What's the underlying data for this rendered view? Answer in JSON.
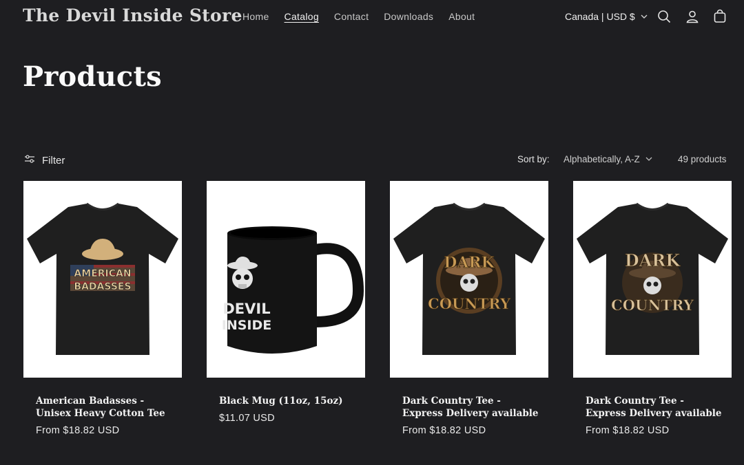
{
  "store": {
    "name": "The Devil Inside Store"
  },
  "nav": {
    "items": [
      {
        "label": "Home"
      },
      {
        "label": "Catalog"
      },
      {
        "label": "Contact"
      },
      {
        "label": "Downloads"
      },
      {
        "label": "About"
      }
    ]
  },
  "header": {
    "locale": "Canada | USD $",
    "icons": [
      "search-icon",
      "account-icon",
      "cart-icon",
      "chevron-down-icon"
    ]
  },
  "page": {
    "title": "Products"
  },
  "toolbar": {
    "filter_label": "Filter",
    "sort_label": "Sort by:",
    "sort_value": "Alphabetically, A-Z",
    "count": "49 products"
  },
  "products": [
    {
      "name": "American Badasses - Unisex Heavy Cotton Tee",
      "price": "From $18.82 USD",
      "art_lines": [
        "AMERICAN",
        "BADASSES"
      ]
    },
    {
      "name": "Black Mug (11oz, 15oz)",
      "price": "$11.07 USD",
      "art_lines": [
        "DEVIL",
        "INSIDE"
      ]
    },
    {
      "name": "Dark Country Tee - Express Delivery available",
      "price": "From $18.82 USD",
      "art_lines": [
        "DARK",
        "COUNTRY"
      ]
    },
    {
      "name": "Dark Country Tee - Express Delivery available",
      "price": "From $18.82 USD",
      "art_lines": [
        "DARK",
        "COUNTRY"
      ]
    }
  ],
  "colors": {
    "background": "#1e1e21",
    "text": "#ededed",
    "card_bg": "#ffffff",
    "shirt": "#1f1f1f",
    "print_gold": "#c89a55"
  }
}
